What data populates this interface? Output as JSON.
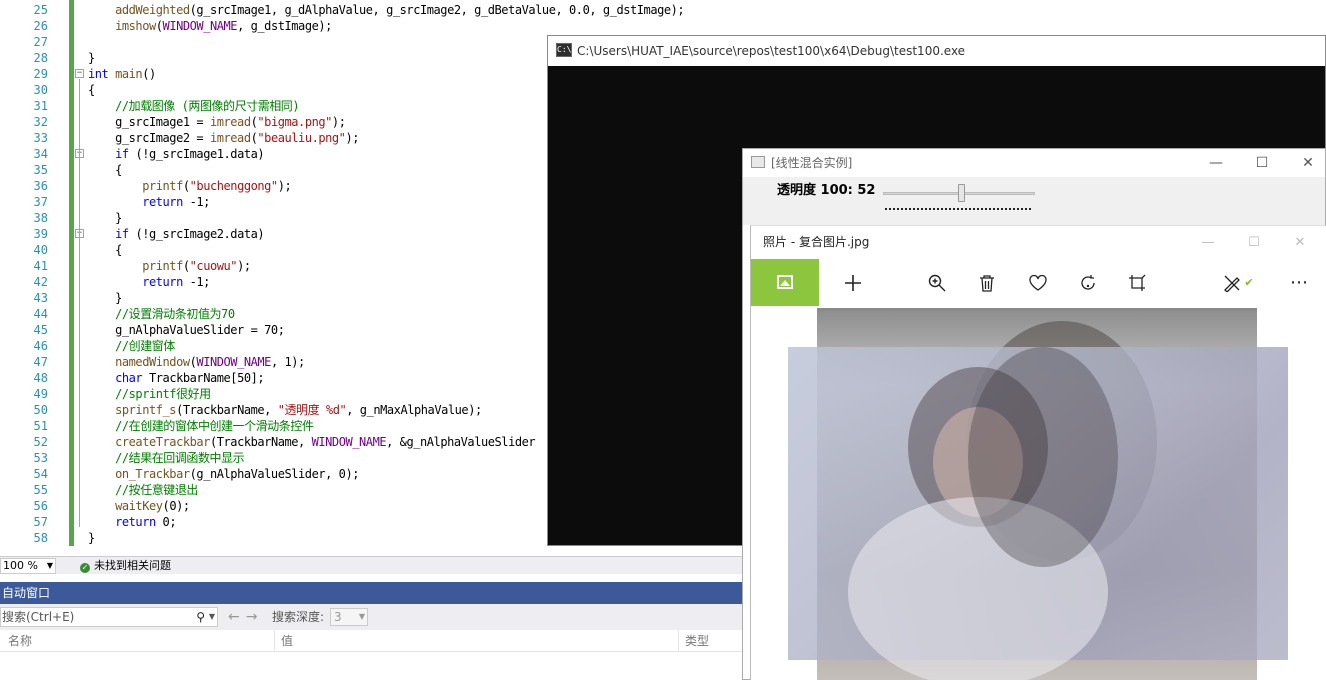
{
  "editor": {
    "lines": [
      {
        "n": "25",
        "code": [
          [
            "",
            "    "
          ],
          [
            "fn",
            "addWeighted"
          ],
          [
            "",
            "(g_srcImage1, g_dAlphaValue, g_srcImage2, g_dBetaValue, 0.0, g_dstImage);"
          ]
        ]
      },
      {
        "n": "26",
        "code": [
          [
            "",
            "    "
          ],
          [
            "fn",
            "imshow"
          ],
          [
            "",
            "("
          ],
          [
            "mac",
            "WINDOW_NAME"
          ],
          [
            "",
            ", g_dstImage);"
          ]
        ]
      },
      {
        "n": "27",
        "code": [
          [
            "",
            ""
          ]
        ]
      },
      {
        "n": "28",
        "code": [
          [
            "",
            "}"
          ]
        ]
      },
      {
        "n": "29",
        "code": [
          [
            "kw",
            "int"
          ],
          [
            "",
            " "
          ],
          [
            "fn",
            "main"
          ],
          [
            "",
            "()"
          ]
        ]
      },
      {
        "n": "30",
        "code": [
          [
            "",
            "{"
          ]
        ]
      },
      {
        "n": "31",
        "code": [
          [
            "",
            "    "
          ],
          [
            "cm",
            "//加载图像 (两图像的尺寸需相同)"
          ]
        ]
      },
      {
        "n": "32",
        "code": [
          [
            "",
            "    g_srcImage1 = "
          ],
          [
            "fn",
            "imread"
          ],
          [
            "",
            "("
          ],
          [
            "st",
            "\"bigma.png\""
          ],
          [
            "",
            ");"
          ]
        ]
      },
      {
        "n": "33",
        "code": [
          [
            "",
            "    g_srcImage2 = "
          ],
          [
            "fn",
            "imread"
          ],
          [
            "",
            "("
          ],
          [
            "st",
            "\"beauliu.png\""
          ],
          [
            "",
            ");"
          ]
        ]
      },
      {
        "n": "34",
        "code": [
          [
            "",
            "    "
          ],
          [
            "kw",
            "if"
          ],
          [
            "",
            " (!g_srcImage1.data)"
          ]
        ]
      },
      {
        "n": "35",
        "code": [
          [
            "",
            "    {"
          ]
        ]
      },
      {
        "n": "36",
        "code": [
          [
            "",
            "        "
          ],
          [
            "fn",
            "printf"
          ],
          [
            "",
            "("
          ],
          [
            "st",
            "\"buchenggong\""
          ],
          [
            "",
            ");"
          ]
        ]
      },
      {
        "n": "37",
        "code": [
          [
            "",
            "        "
          ],
          [
            "kw",
            "return"
          ],
          [
            "",
            " -1;"
          ]
        ]
      },
      {
        "n": "38",
        "code": [
          [
            "",
            "    }"
          ]
        ]
      },
      {
        "n": "39",
        "code": [
          [
            "",
            "    "
          ],
          [
            "kw",
            "if"
          ],
          [
            "",
            " (!g_srcImage2.data)"
          ]
        ]
      },
      {
        "n": "40",
        "code": [
          [
            "",
            "    {"
          ]
        ]
      },
      {
        "n": "41",
        "code": [
          [
            "",
            "        "
          ],
          [
            "fn",
            "printf"
          ],
          [
            "",
            "("
          ],
          [
            "st",
            "\"cuowu\""
          ],
          [
            "",
            ");"
          ]
        ]
      },
      {
        "n": "42",
        "code": [
          [
            "",
            "        "
          ],
          [
            "kw",
            "return"
          ],
          [
            "",
            " -1;"
          ]
        ]
      },
      {
        "n": "43",
        "code": [
          [
            "",
            "    }"
          ]
        ]
      },
      {
        "n": "44",
        "code": [
          [
            "",
            "    "
          ],
          [
            "cm",
            "//设置滑动条初值为70"
          ]
        ]
      },
      {
        "n": "45",
        "code": [
          [
            "",
            "    g_nAlphaValueSlider = 70;"
          ]
        ]
      },
      {
        "n": "46",
        "code": [
          [
            "",
            "    "
          ],
          [
            "cm",
            "//创建窗体"
          ]
        ]
      },
      {
        "n": "47",
        "code": [
          [
            "",
            "    "
          ],
          [
            "fn",
            "namedWindow"
          ],
          [
            "",
            "("
          ],
          [
            "mac",
            "WINDOW_NAME"
          ],
          [
            "",
            ", 1);"
          ]
        ]
      },
      {
        "n": "48",
        "code": [
          [
            "",
            "    "
          ],
          [
            "kw",
            "char"
          ],
          [
            "",
            " TrackbarName[50];"
          ]
        ]
      },
      {
        "n": "49",
        "code": [
          [
            "",
            "    "
          ],
          [
            "cm",
            "//sprintf很好用"
          ]
        ]
      },
      {
        "n": "50",
        "code": [
          [
            "",
            "    "
          ],
          [
            "fn",
            "sprintf_s"
          ],
          [
            "",
            "(TrackbarName, "
          ],
          [
            "st",
            "\"透明度 %d\""
          ],
          [
            "",
            ", g_nMaxAlphaValue);"
          ]
        ]
      },
      {
        "n": "51",
        "code": [
          [
            "",
            "    "
          ],
          [
            "cm",
            "//在创建的窗体中创建一个滑动条控件"
          ]
        ]
      },
      {
        "n": "52",
        "code": [
          [
            "",
            "    "
          ],
          [
            "fn",
            "createTrackbar"
          ],
          [
            "",
            "(TrackbarName, "
          ],
          [
            "mac",
            "WINDOW_NAME"
          ],
          [
            "",
            ", &g_nAlphaValueSlider"
          ]
        ]
      },
      {
        "n": "53",
        "code": [
          [
            "",
            "    "
          ],
          [
            "cm",
            "//结果在回调函数中显示"
          ]
        ]
      },
      {
        "n": "54",
        "code": [
          [
            "",
            "    "
          ],
          [
            "fn",
            "on_Trackbar"
          ],
          [
            "",
            "(g_nAlphaValueSlider, 0);"
          ]
        ]
      },
      {
        "n": "55",
        "code": [
          [
            "",
            "    "
          ],
          [
            "cm",
            "//按任意键退出"
          ]
        ]
      },
      {
        "n": "56",
        "code": [
          [
            "",
            "    "
          ],
          [
            "fn",
            "waitKey"
          ],
          [
            "",
            "(0);"
          ]
        ]
      },
      {
        "n": "57",
        "code": [
          [
            "",
            "    "
          ],
          [
            "kw",
            "return"
          ],
          [
            "",
            " 0;"
          ]
        ]
      },
      {
        "n": "58",
        "code": [
          [
            "",
            "}"
          ]
        ]
      }
    ],
    "zoom": "100 %",
    "issues_text": "未找到相关问题"
  },
  "autos": {
    "title": "自动窗口",
    "search_placeholder": "搜索(Ctrl+E)",
    "depth_label": "搜索深度:",
    "depth_value": "3",
    "columns": [
      "名称",
      "值",
      "类型"
    ]
  },
  "console": {
    "title": "C:\\Users\\HUAT_IAE\\source\\repos\\test100\\x64\\Debug\\test100.exe",
    "icon_text": "C:\\"
  },
  "cv_window": {
    "title": "[线性混合实例]",
    "trackbar_label": "透明度 100: 52",
    "trackbar_value": 52,
    "trackbar_max": 100
  },
  "photos": {
    "title": "照片 - 复合图片.jpg",
    "minimize": "—",
    "maximize": "☐",
    "close": "✕"
  },
  "colors": {
    "accent_green": "#8cc63e",
    "vs_blue": "#3c5a9a",
    "change_bar": "#57a64a"
  }
}
